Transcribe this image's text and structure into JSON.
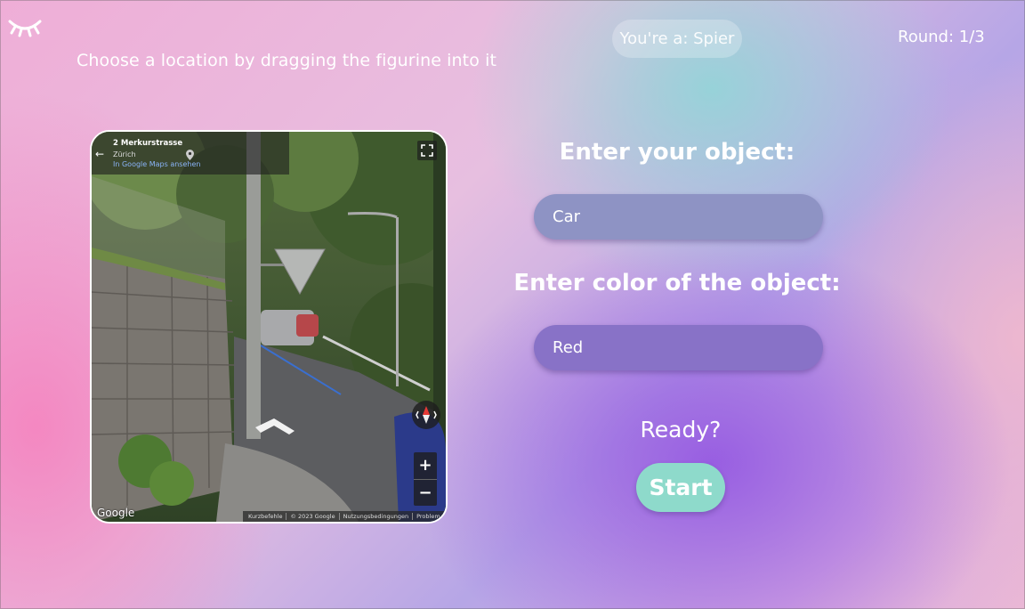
{
  "header": {
    "instruction": "Choose a location by dragging the figurine into it",
    "role_badge": "You're a: Spier",
    "round": "Round: 1/3",
    "logo_icon": "eye-closed-icon"
  },
  "street_view": {
    "address": "2 Merkurstrasse",
    "city": "Zürich",
    "maps_link": "In Google Maps ansehen",
    "google_logo": "Google",
    "zoom_in": "+",
    "zoom_out": "−",
    "footer": [
      "Kurzbefehle",
      "© 2023 Google",
      "Nutzungsbedingungen",
      "Problem melden"
    ]
  },
  "form": {
    "object_label": "Enter your object:",
    "object_value": "Car",
    "color_label": "Enter color of the object:",
    "color_value": "Red",
    "ready_text": "Ready?",
    "start_label": "Start"
  },
  "colors": {
    "start_button": "#8edacb",
    "object_field": "#8e93c4",
    "color_field": "#8872c7"
  }
}
